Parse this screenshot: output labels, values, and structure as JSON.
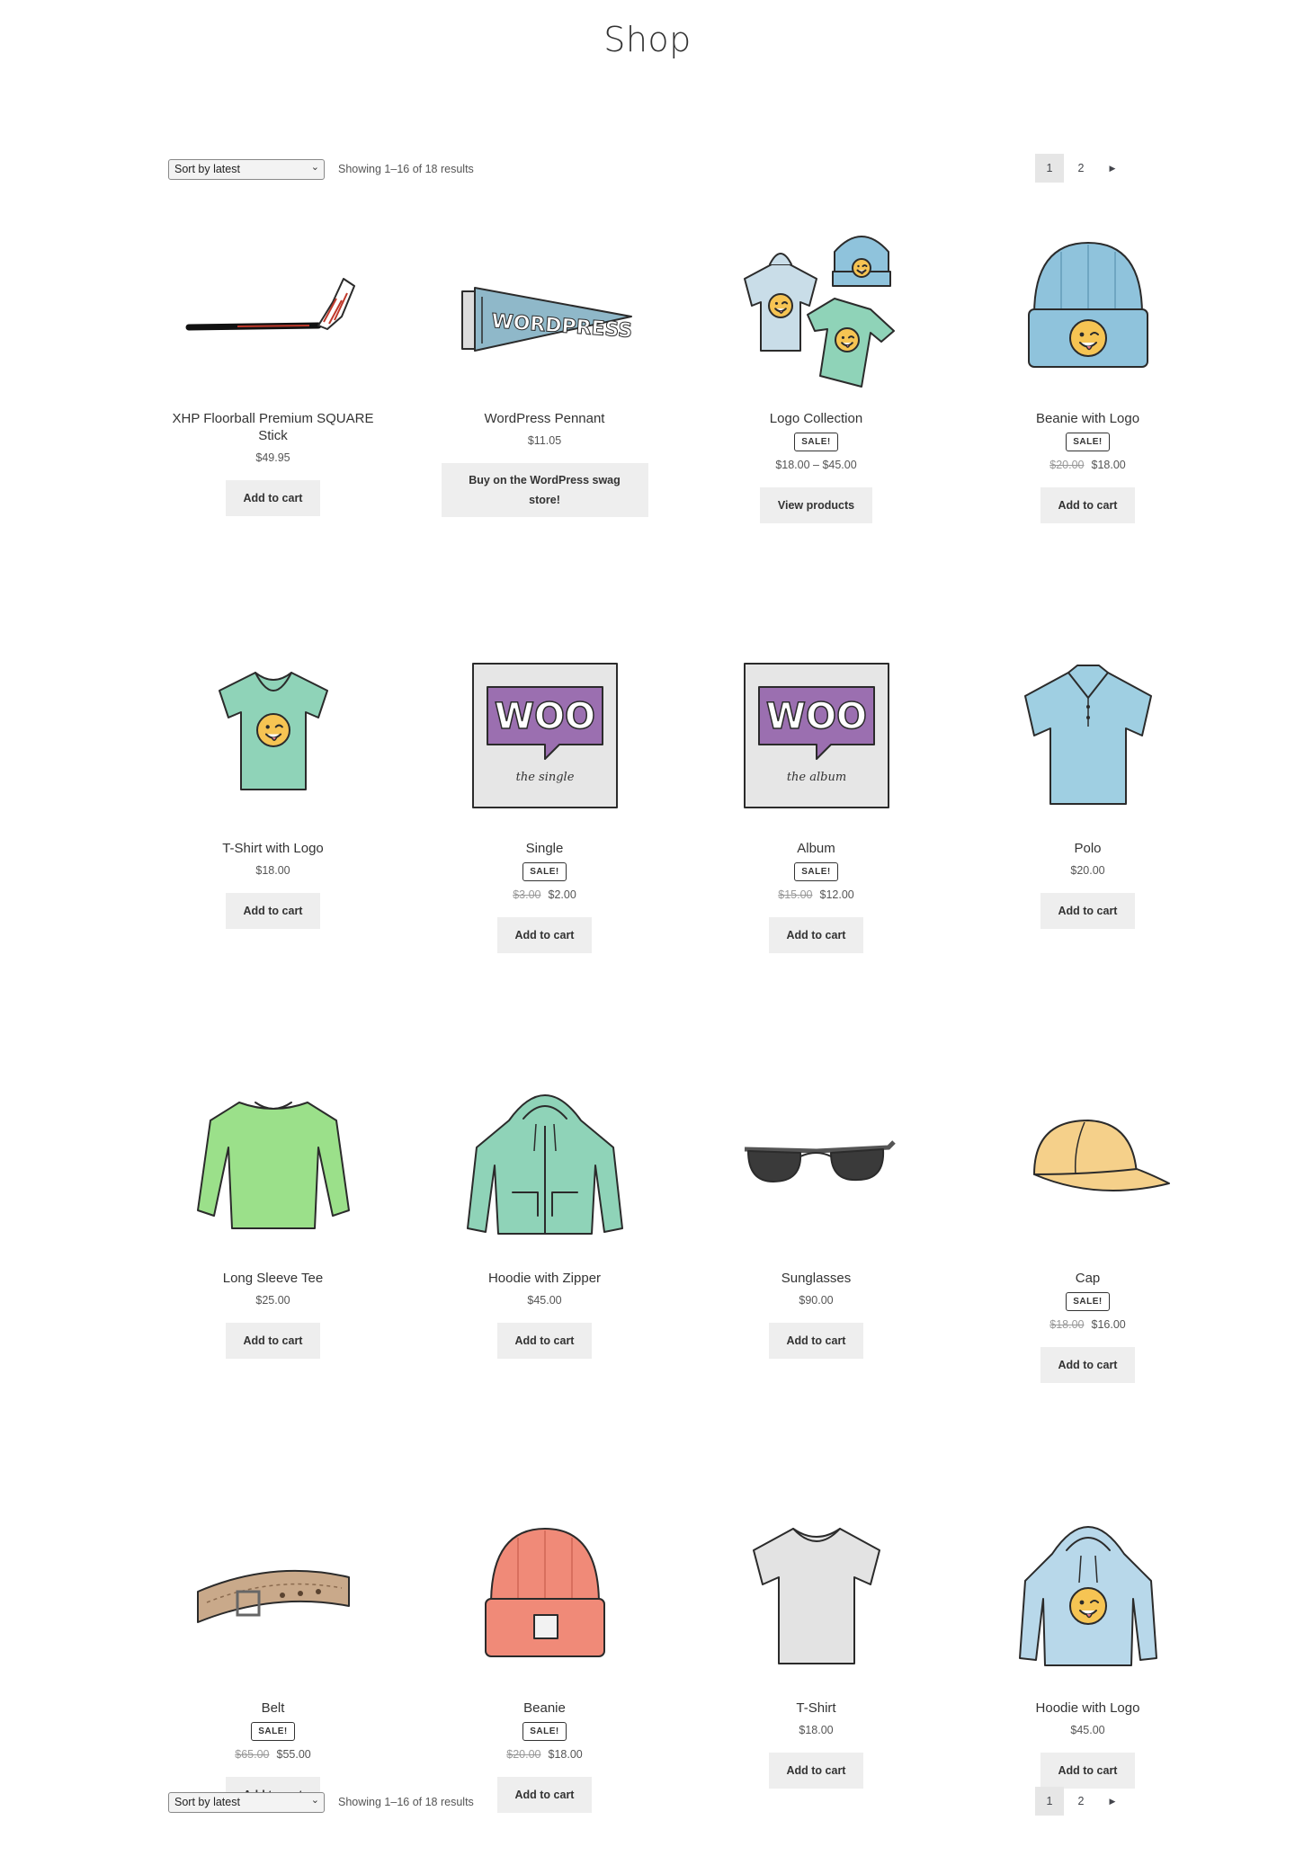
{
  "page": {
    "title": "Shop"
  },
  "toolbar": {
    "sort_value": "Sort by latest",
    "result_count": "Showing 1–16 of 18 results",
    "pages": [
      "1",
      "2"
    ],
    "current_page": "1",
    "next_icon": "triangle-right-icon"
  },
  "products": [
    {
      "name": "XHP Floorball Premium SQUARE Stick",
      "icon": "floorball-stick",
      "sale": false,
      "price": "$49.95",
      "button": "Add to cart"
    },
    {
      "name": "WordPress Pennant",
      "icon": "pennant",
      "sale": false,
      "price": "$11.05",
      "button": "Buy on the WordPress swag store!"
    },
    {
      "name": "Logo Collection",
      "icon": "logo-collection",
      "sale": true,
      "sale_label": "SALE!",
      "price": "$18.00 – $45.00",
      "button": "View products"
    },
    {
      "name": "Beanie with Logo",
      "icon": "beanie-logo",
      "sale": true,
      "sale_label": "SALE!",
      "old_price": "$20.00",
      "price": "$18.00",
      "button": "Add to cart"
    },
    {
      "name": "T-Shirt with Logo",
      "icon": "tshirt-logo",
      "sale": false,
      "price": "$18.00",
      "button": "Add to cart"
    },
    {
      "name": "Single",
      "icon": "woo-single",
      "sale": true,
      "sale_label": "SALE!",
      "old_price": "$3.00",
      "price": "$2.00",
      "button": "Add to cart"
    },
    {
      "name": "Album",
      "icon": "woo-album",
      "sale": true,
      "sale_label": "SALE!",
      "old_price": "$15.00",
      "price": "$12.00",
      "button": "Add to cart"
    },
    {
      "name": "Polo",
      "icon": "polo",
      "sale": false,
      "price": "$20.00",
      "button": "Add to cart"
    },
    {
      "name": "Long Sleeve Tee",
      "icon": "long-sleeve",
      "sale": false,
      "price": "$25.00",
      "button": "Add to cart"
    },
    {
      "name": "Hoodie with Zipper",
      "icon": "hoodie-zipper",
      "sale": false,
      "price": "$45.00",
      "button": "Add to cart"
    },
    {
      "name": "Sunglasses",
      "icon": "sunglasses",
      "sale": false,
      "price": "$90.00",
      "button": "Add to cart"
    },
    {
      "name": "Cap",
      "icon": "cap",
      "sale": true,
      "sale_label": "SALE!",
      "old_price": "$18.00",
      "price": "$16.00",
      "button": "Add to cart"
    },
    {
      "name": "Belt",
      "icon": "belt",
      "sale": true,
      "sale_label": "SALE!",
      "old_price": "$65.00",
      "price": "$55.00",
      "button": "Add to cart"
    },
    {
      "name": "Beanie",
      "icon": "beanie",
      "sale": true,
      "sale_label": "SALE!",
      "old_price": "$20.00",
      "price": "$18.00",
      "button": "Add to cart"
    },
    {
      "name": "T-Shirt",
      "icon": "tshirt",
      "sale": false,
      "price": "$18.00",
      "button": "Add to cart"
    },
    {
      "name": "Hoodie with Logo",
      "icon": "hoodie-logo",
      "sale": false,
      "price": "$45.00",
      "button": "Add to cart"
    }
  ],
  "woo_art": {
    "wordmark": "WOO",
    "single_caption": "the single",
    "album_caption": "the album",
    "pennant_text": "WORDPRESS"
  }
}
